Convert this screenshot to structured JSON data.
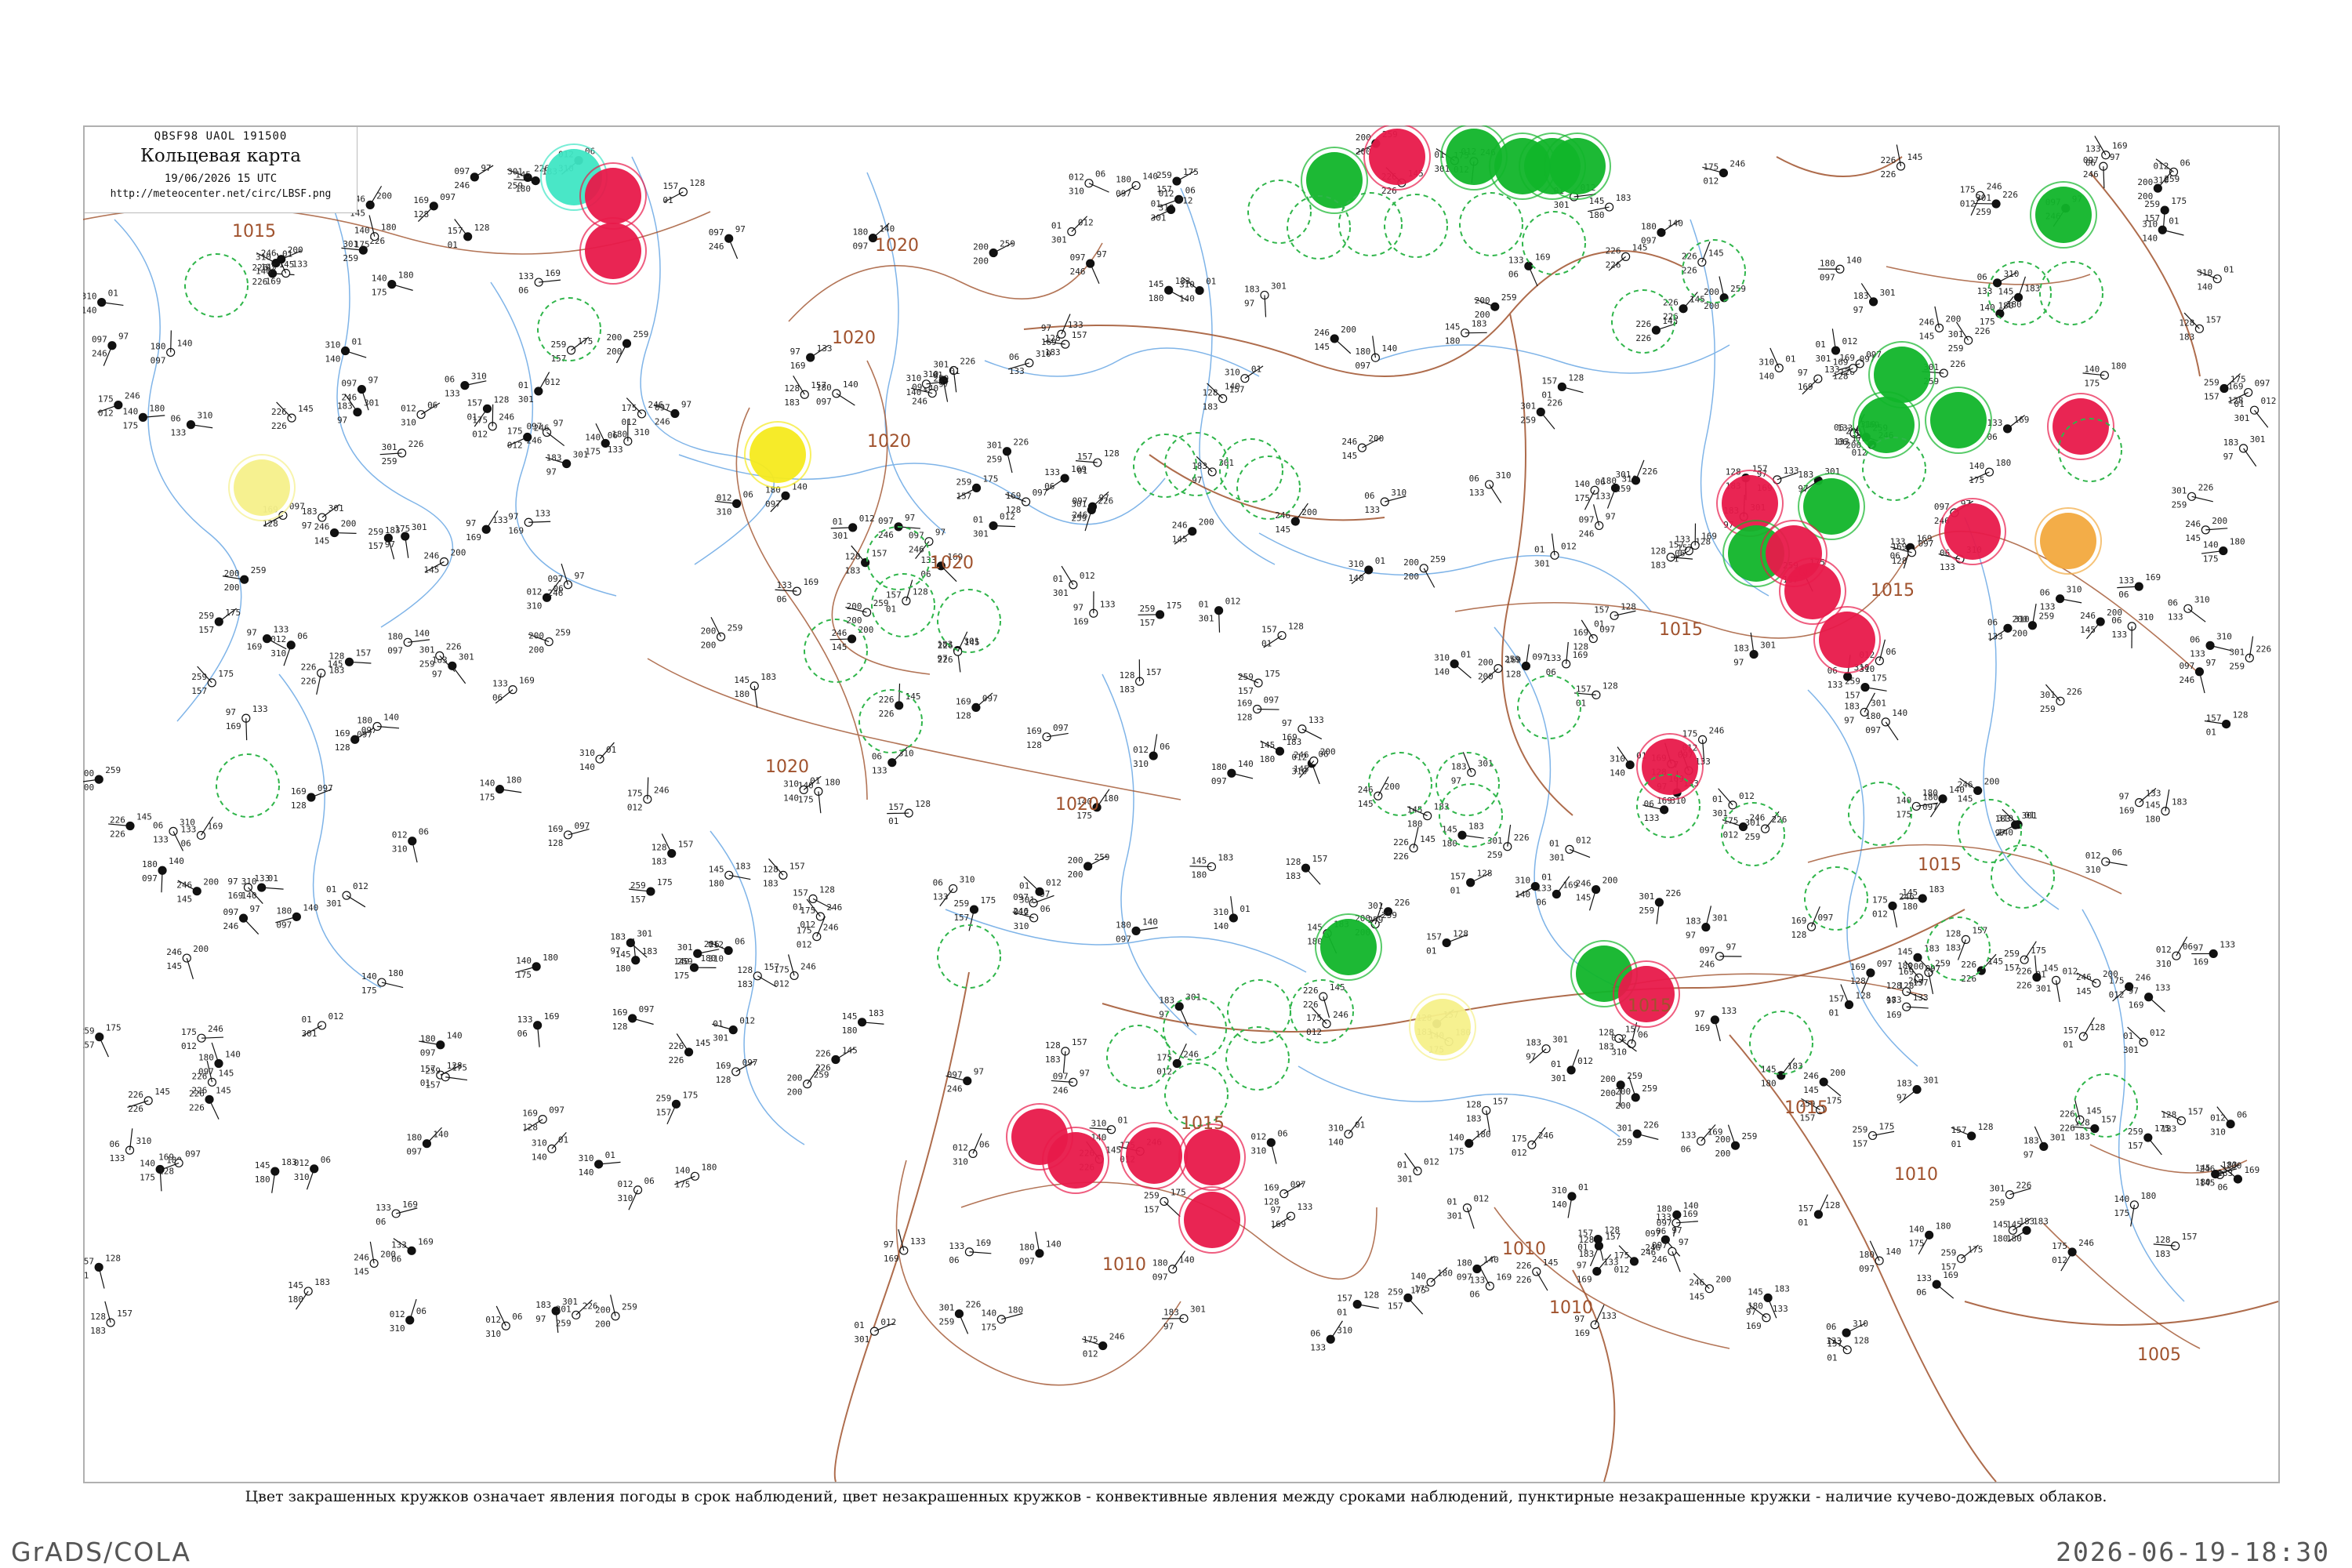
{
  "header": {
    "bulletin": "QBSF98 UAOL 191500",
    "title": "Кольцевая карта",
    "datetime": "19/06/2026 15 UTC",
    "url": "http://meteocenter.net/circ/LBSF.png"
  },
  "legend_caption": "Цвет закрашенных кружков означает явления погоды в срок наблюдений, цвет незакрашенных кружков - конвективные явления между сроками наблюдений, пунктирные незакрашенные кружки - наличие кучево-дождевых облаков.",
  "footer": {
    "software": "GrADS/COLA",
    "timestamp": "2026-06-19-18:30"
  },
  "colors": {
    "rain_red": "#e8194a",
    "shower_green": "#11b52a",
    "drizzle_yellow": "#f5ea1e",
    "pale_yellow": "#f5f08a",
    "fog_orange": "#f2a93e",
    "cyan": "#3fe6c4",
    "isobar": "#a0522d",
    "border": "#a0522d",
    "river": "#7fb4e8",
    "cb_ring": "#2fb54a"
  },
  "isobars": {
    "labels": [
      "1015",
      "1020",
      "1020",
      "1020",
      "1020",
      "1020",
      "1020",
      "1015",
      "1015",
      "1015",
      "1015",
      "1015",
      "1015",
      "1010",
      "1010",
      "1010",
      "1010",
      "1005"
    ]
  },
  "station_values": [
    "157",
    "97",
    "01",
    "200",
    "145",
    "128",
    "246",
    "175",
    "133",
    "169",
    "180",
    "012",
    "097",
    "226",
    "259",
    "140",
    "301",
    "183",
    "06",
    "310"
  ]
}
